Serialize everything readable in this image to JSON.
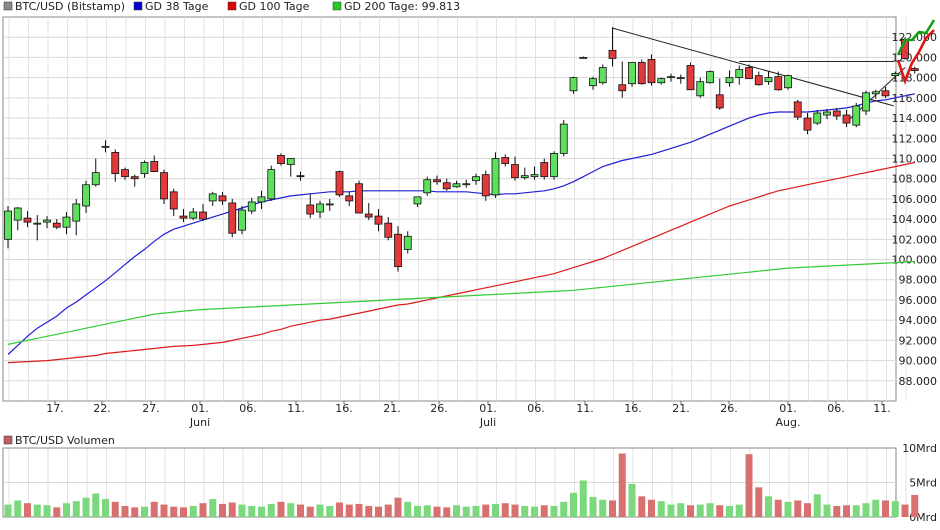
{
  "chart_data": [
    {
      "type": "candlestick",
      "title": "BTC/USD (Bitstamp)",
      "legend": [
        {
          "label": "BTC/USD (Bitstamp)",
          "color": "#8a8a8a"
        },
        {
          "label": "GD 38 Tage",
          "color": "#0000cc"
        },
        {
          "label": "GD 100 Tage",
          "color": "#dd0000"
        },
        {
          "label": "GD 200 Tage: 99.813",
          "color": "#22cc22"
        }
      ],
      "y_axis": {
        "min": 86000,
        "max": 124000,
        "tick_labels": [
          "88.000",
          "90.000",
          "92.000",
          "94.000",
          "96.000",
          "98.000",
          "100.000",
          "102.000",
          "104.000",
          "106.000",
          "108.000",
          "110.000",
          "112.000",
          "114.000",
          "116.000",
          "118.000",
          "120.000",
          "122.000"
        ]
      },
      "x_axis": {
        "tick_labels": [
          "17.",
          "22.",
          "27.",
          "01.",
          "06.",
          "11.",
          "16.",
          "21.",
          "26.",
          "01.",
          "06.",
          "11.",
          "16.",
          "21.",
          "26.",
          "01.",
          "06.",
          "11."
        ],
        "month_labels": [
          "Juni",
          "Juli",
          "Aug."
        ]
      },
      "grid": true,
      "candles": [
        {
          "o": 102000,
          "h": 105300,
          "l": 101100,
          "c": 104800
        },
        {
          "o": 103900,
          "h": 105200,
          "l": 102900,
          "c": 105100
        },
        {
          "o": 104100,
          "h": 104800,
          "l": 103200,
          "c": 103700
        },
        {
          "o": 103600,
          "h": 104400,
          "l": 101900,
          "c": 103600
        },
        {
          "o": 103700,
          "h": 104300,
          "l": 103100,
          "c": 103900
        },
        {
          "o": 103600,
          "h": 104000,
          "l": 103000,
          "c": 103200
        },
        {
          "o": 103200,
          "h": 104700,
          "l": 102500,
          "c": 104200
        },
        {
          "o": 103800,
          "h": 106000,
          "l": 102400,
          "c": 105500
        },
        {
          "o": 105300,
          "h": 107800,
          "l": 104600,
          "c": 107400
        },
        {
          "o": 107400,
          "h": 110000,
          "l": 107200,
          "c": 108600
        },
        {
          "o": 111200,
          "h": 111800,
          "l": 110600,
          "c": 111200
        },
        {
          "o": 110600,
          "h": 110900,
          "l": 107700,
          "c": 108500
        },
        {
          "o": 108900,
          "h": 109100,
          "l": 107900,
          "c": 108200
        },
        {
          "o": 108200,
          "h": 108400,
          "l": 107200,
          "c": 108000
        },
        {
          "o": 108500,
          "h": 109800,
          "l": 108100,
          "c": 109600
        },
        {
          "o": 109700,
          "h": 110300,
          "l": 108700,
          "c": 108700
        },
        {
          "o": 108600,
          "h": 108900,
          "l": 105500,
          "c": 106000
        },
        {
          "o": 106700,
          "h": 107000,
          "l": 104300,
          "c": 105000
        },
        {
          "o": 104300,
          "h": 105000,
          "l": 103700,
          "c": 104100
        },
        {
          "o": 104100,
          "h": 105100,
          "l": 103900,
          "c": 104700
        },
        {
          "o": 104700,
          "h": 105500,
          "l": 103800,
          "c": 104000
        },
        {
          "o": 105800,
          "h": 106700,
          "l": 105300,
          "c": 106500
        },
        {
          "o": 106300,
          "h": 106700,
          "l": 105400,
          "c": 105800
        },
        {
          "o": 105600,
          "h": 106000,
          "l": 102200,
          "c": 102600
        },
        {
          "o": 102900,
          "h": 105300,
          "l": 102500,
          "c": 104900
        },
        {
          "o": 104800,
          "h": 106100,
          "l": 104500,
          "c": 105700
        },
        {
          "o": 105700,
          "h": 106800,
          "l": 105000,
          "c": 106200
        },
        {
          "o": 106000,
          "h": 109300,
          "l": 105800,
          "c": 108900
        },
        {
          "o": 110300,
          "h": 110500,
          "l": 109300,
          "c": 109500
        },
        {
          "o": 109400,
          "h": 110000,
          "l": 108200,
          "c": 110000
        },
        {
          "o": 108300,
          "h": 108700,
          "l": 107800,
          "c": 108200
        },
        {
          "o": 105400,
          "h": 106500,
          "l": 104100,
          "c": 104500
        },
        {
          "o": 104700,
          "h": 105800,
          "l": 104100,
          "c": 105500
        },
        {
          "o": 105500,
          "h": 106000,
          "l": 104800,
          "c": 105500
        },
        {
          "o": 108700,
          "h": 108800,
          "l": 106200,
          "c": 106400
        },
        {
          "o": 106300,
          "h": 106700,
          "l": 105300,
          "c": 105800
        },
        {
          "o": 107500,
          "h": 107800,
          "l": 104600,
          "c": 104600
        },
        {
          "o": 104500,
          "h": 105600,
          "l": 103900,
          "c": 104200
        },
        {
          "o": 104300,
          "h": 105000,
          "l": 102800,
          "c": 103500
        },
        {
          "o": 103600,
          "h": 104200,
          "l": 101900,
          "c": 102200
        },
        {
          "o": 102500,
          "h": 103300,
          "l": 98800,
          "c": 99300
        },
        {
          "o": 101000,
          "h": 102800,
          "l": 100600,
          "c": 102300
        },
        {
          "o": 105500,
          "h": 106200,
          "l": 105200,
          "c": 106200
        },
        {
          "o": 106600,
          "h": 108200,
          "l": 106300,
          "c": 107900
        },
        {
          "o": 107900,
          "h": 108300,
          "l": 107400,
          "c": 107700
        },
        {
          "o": 107600,
          "h": 108000,
          "l": 106800,
          "c": 107000
        },
        {
          "o": 107200,
          "h": 107800,
          "l": 107100,
          "c": 107500
        },
        {
          "o": 107500,
          "h": 107900,
          "l": 107100,
          "c": 107500
        },
        {
          "o": 107800,
          "h": 108500,
          "l": 107400,
          "c": 108200
        },
        {
          "o": 108400,
          "h": 108800,
          "l": 105800,
          "c": 106300
        },
        {
          "o": 106400,
          "h": 110600,
          "l": 106100,
          "c": 110000
        },
        {
          "o": 110100,
          "h": 110400,
          "l": 109200,
          "c": 109500
        },
        {
          "o": 109400,
          "h": 110200,
          "l": 107800,
          "c": 108100
        },
        {
          "o": 108100,
          "h": 109100,
          "l": 107900,
          "c": 108300
        },
        {
          "o": 108200,
          "h": 109200,
          "l": 107900,
          "c": 108400
        },
        {
          "o": 109600,
          "h": 110000,
          "l": 107900,
          "c": 108200
        },
        {
          "o": 108200,
          "h": 110700,
          "l": 107900,
          "c": 110500
        },
        {
          "o": 110500,
          "h": 113800,
          "l": 110200,
          "c": 113400
        },
        {
          "o": 116700,
          "h": 118100,
          "l": 116400,
          "c": 118000
        },
        {
          "o": 120000,
          "h": 120100,
          "l": 120000,
          "c": 120000
        },
        {
          "o": 117200,
          "h": 118100,
          "l": 116800,
          "c": 117900
        },
        {
          "o": 117500,
          "h": 119300,
          "l": 117300,
          "c": 119000
        },
        {
          "o": 120700,
          "h": 123000,
          "l": 119100,
          "c": 119900
        },
        {
          "o": 117300,
          "h": 119600,
          "l": 116000,
          "c": 116700
        },
        {
          "o": 117400,
          "h": 119500,
          "l": 117100,
          "c": 119500
        },
        {
          "o": 119500,
          "h": 119800,
          "l": 117300,
          "c": 117400
        },
        {
          "o": 119800,
          "h": 120300,
          "l": 117200,
          "c": 117500
        },
        {
          "o": 117500,
          "h": 118000,
          "l": 117300,
          "c": 117900
        },
        {
          "o": 118000,
          "h": 118400,
          "l": 117600,
          "c": 118100
        },
        {
          "o": 118000,
          "h": 118300,
          "l": 117400,
          "c": 118000
        },
        {
          "o": 119200,
          "h": 119500,
          "l": 116800,
          "c": 116800
        },
        {
          "o": 116200,
          "h": 118000,
          "l": 116000,
          "c": 117600
        },
        {
          "o": 117500,
          "h": 118700,
          "l": 117400,
          "c": 118600
        },
        {
          "o": 116300,
          "h": 117900,
          "l": 114800,
          "c": 115000
        },
        {
          "o": 117500,
          "h": 118700,
          "l": 117100,
          "c": 118000
        },
        {
          "o": 118000,
          "h": 119200,
          "l": 117300,
          "c": 118800
        },
        {
          "o": 119000,
          "h": 119300,
          "l": 117900,
          "c": 117900
        },
        {
          "o": 118200,
          "h": 118600,
          "l": 117200,
          "c": 117300
        },
        {
          "o": 117600,
          "h": 118600,
          "l": 117300,
          "c": 118000
        },
        {
          "o": 118100,
          "h": 118600,
          "l": 116700,
          "c": 116800
        },
        {
          "o": 117000,
          "h": 118300,
          "l": 116800,
          "c": 118200
        },
        {
          "o": 115600,
          "h": 115800,
          "l": 113800,
          "c": 114100
        },
        {
          "o": 114000,
          "h": 114500,
          "l": 112400,
          "c": 112800
        },
        {
          "o": 113500,
          "h": 114800,
          "l": 113300,
          "c": 114500
        },
        {
          "o": 114300,
          "h": 114900,
          "l": 113900,
          "c": 114600
        },
        {
          "o": 114700,
          "h": 115000,
          "l": 113800,
          "c": 114200
        },
        {
          "o": 114300,
          "h": 114800,
          "l": 113100,
          "c": 113500
        },
        {
          "o": 113300,
          "h": 115500,
          "l": 113100,
          "c": 115200
        },
        {
          "o": 114700,
          "h": 116700,
          "l": 114300,
          "c": 116500
        },
        {
          "o": 116400,
          "h": 116800,
          "l": 115900,
          "c": 116600
        },
        {
          "o": 116700,
          "h": 117100,
          "l": 116000,
          "c": 116200
        },
        {
          "o": 118200,
          "h": 118600,
          "l": 117900,
          "c": 118400
        },
        {
          "o": 121800,
          "h": 122000,
          "l": 119800,
          "c": 119900
        },
        {
          "o": 118900,
          "h": 119100,
          "l": 118400,
          "c": 118700
        }
      ],
      "series": [
        {
          "name": "GD 38 Tage",
          "color": "#1f1fd6",
          "values": [
            90600,
            91500,
            92400,
            93200,
            93800,
            94400,
            95200,
            95800,
            96500,
            97200,
            97900,
            98700,
            99500,
            100300,
            101000,
            101800,
            102500,
            103000,
            103300,
            103600,
            103900,
            104200,
            104500,
            104800,
            105100,
            105400,
            105700,
            105900,
            106100,
            106300,
            106400,
            106500,
            106600,
            106700,
            106700,
            106700,
            106800,
            106800,
            106800,
            106800,
            106800,
            106800,
            106800,
            106800,
            106700,
            106700,
            106700,
            106700,
            106600,
            106500,
            106400,
            106500,
            106500,
            106600,
            106700,
            106800,
            107000,
            107300,
            107700,
            108200,
            108700,
            109200,
            109500,
            109800,
            110000,
            110200,
            110400,
            110700,
            111000,
            111300,
            111600,
            112000,
            112400,
            112800,
            113200,
            113600,
            114000,
            114300,
            114500,
            114600,
            114600,
            114600,
            114600,
            114700,
            114800,
            114900,
            115000,
            115200,
            115500,
            115700,
            115800,
            116000,
            116200,
            116400
          ]
        },
        {
          "name": "GD 100 Tage",
          "color": "#dd1a1a",
          "values": [
            89800,
            89850,
            89900,
            89950,
            90000,
            90100,
            90200,
            90300,
            90400,
            90500,
            90700,
            90800,
            90900,
            91000,
            91100,
            91200,
            91300,
            91400,
            91450,
            91500,
            91600,
            91700,
            91800,
            92000,
            92200,
            92400,
            92600,
            92900,
            93100,
            93400,
            93600,
            93800,
            94000,
            94100,
            94300,
            94500,
            94700,
            94900,
            95100,
            95300,
            95500,
            95600,
            95800,
            96000,
            96200,
            96400,
            96600,
            96800,
            97000,
            97200,
            97400,
            97600,
            97800,
            98000,
            98200,
            98400,
            98600,
            98900,
            99200,
            99500,
            99800,
            100100,
            100500,
            100900,
            101300,
            101700,
            102100,
            102500,
            102900,
            103300,
            103700,
            104100,
            104500,
            104900,
            105300,
            105600,
            105900,
            106200,
            106500,
            106800,
            107000,
            107200,
            107400,
            107600,
            107800,
            108000,
            108200,
            108400,
            108600,
            108800,
            109000,
            109200,
            109400,
            109600
          ]
        },
        {
          "name": "GD 200 Tage",
          "value_label": "99.813",
          "color": "#33cc33",
          "values": [
            91600,
            91800,
            92000,
            92200,
            92400,
            92600,
            92800,
            93000,
            93200,
            93400,
            93600,
            93800,
            94000,
            94200,
            94400,
            94600,
            94700,
            94800,
            94900,
            95000,
            95050,
            95100,
            95150,
            95200,
            95250,
            95300,
            95350,
            95400,
            95450,
            95500,
            95550,
            95600,
            95650,
            95700,
            95750,
            95800,
            95850,
            95900,
            95950,
            96000,
            96050,
            96100,
            96150,
            96200,
            96250,
            96300,
            96350,
            96400,
            96450,
            96500,
            96550,
            96600,
            96650,
            96700,
            96750,
            96800,
            96850,
            96900,
            96950,
            97050,
            97150,
            97250,
            97350,
            97450,
            97550,
            97650,
            97750,
            97850,
            97950,
            98050,
            98150,
            98250,
            98350,
            98450,
            98550,
            98650,
            98750,
            98850,
            98950,
            99050,
            99150,
            99200,
            99250,
            99300,
            99350,
            99400,
            99450,
            99500,
            99550,
            99600,
            99650,
            99700,
            99750,
            99813
          ]
        }
      ]
    },
    {
      "type": "bar",
      "title": "BTC/USD Volumen",
      "y_axis": {
        "min": 0,
        "max": 10,
        "tick_labels": [
          "0Mrd",
          "5Mrd",
          "10Mrd"
        ],
        "unit": "Mrd"
      },
      "grid": true,
      "values": [
        1.8,
        2.4,
        2.0,
        1.8,
        1.7,
        1.4,
        2.0,
        2.3,
        2.8,
        3.4,
        2.6,
        2.2,
        1.6,
        1.4,
        1.5,
        2.2,
        1.8,
        1.5,
        1.4,
        1.6,
        2.0,
        2.6,
        1.9,
        2.1,
        1.8,
        1.6,
        1.5,
        1.9,
        2.2,
        2.0,
        1.8,
        1.5,
        1.8,
        1.6,
        2.1,
        1.8,
        1.9,
        1.6,
        1.5,
        1.8,
        2.8,
        2.2,
        1.6,
        1.7,
        1.5,
        1.4,
        1.7,
        1.5,
        1.6,
        1.8,
        1.9,
        2.0,
        1.8,
        1.6,
        1.5,
        1.7,
        1.6,
        2.2,
        3.5,
        5.3,
        2.9,
        2.5,
        2.4,
        9.2,
        4.8,
        3.0,
        2.5,
        2.3,
        1.8,
        2.0,
        1.7,
        1.8,
        2.0,
        1.7,
        1.6,
        1.8,
        9.1,
        4.3,
        3.0,
        2.5,
        2.2,
        2.4,
        2.0,
        3.3,
        1.8,
        1.6,
        1.7,
        1.7,
        2.0,
        2.5,
        2.4,
        2.3,
        1.8,
        3.2
      ]
    }
  ],
  "axis_labels": {
    "june": "Juni",
    "july": "Juli",
    "august": "Aug."
  }
}
